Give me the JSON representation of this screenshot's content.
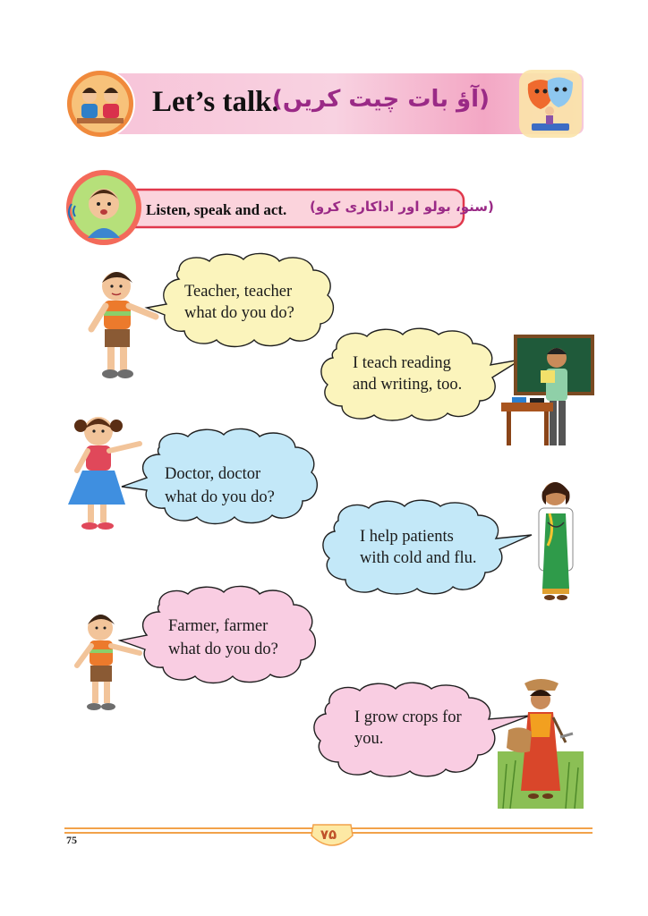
{
  "header": {
    "title": "Let’s talk.",
    "urdu_title": "(آؤ بات چیت کریں)"
  },
  "instruction": {
    "text": "Listen, speak and act.",
    "urdu": "(سنو، بولو اور اداکاری کرو)"
  },
  "dialogues": [
    {
      "question": [
        "Teacher, teacher",
        "what do you do?"
      ],
      "answer": [
        "I teach reading",
        "and writing, too."
      ]
    },
    {
      "question": [
        "Doctor, doctor",
        "what do you do?"
      ],
      "answer": [
        "I help patients",
        "with cold and flu."
      ]
    },
    {
      "question": [
        "Farmer, farmer",
        "what do you do?"
      ],
      "answer": [
        "I grow crops for",
        "you."
      ]
    }
  ],
  "footer": {
    "page_number": "75",
    "urdu_page_number": "۷۵"
  },
  "colors": {
    "banner_pink": "#f4b6cf",
    "instruction_outline": "#e0384c",
    "bubble_yellow": "#fbf4bc",
    "bubble_blue": "#c3e8f8",
    "bubble_pink": "#f9cde2",
    "footer_orange": "#f2a24a"
  }
}
